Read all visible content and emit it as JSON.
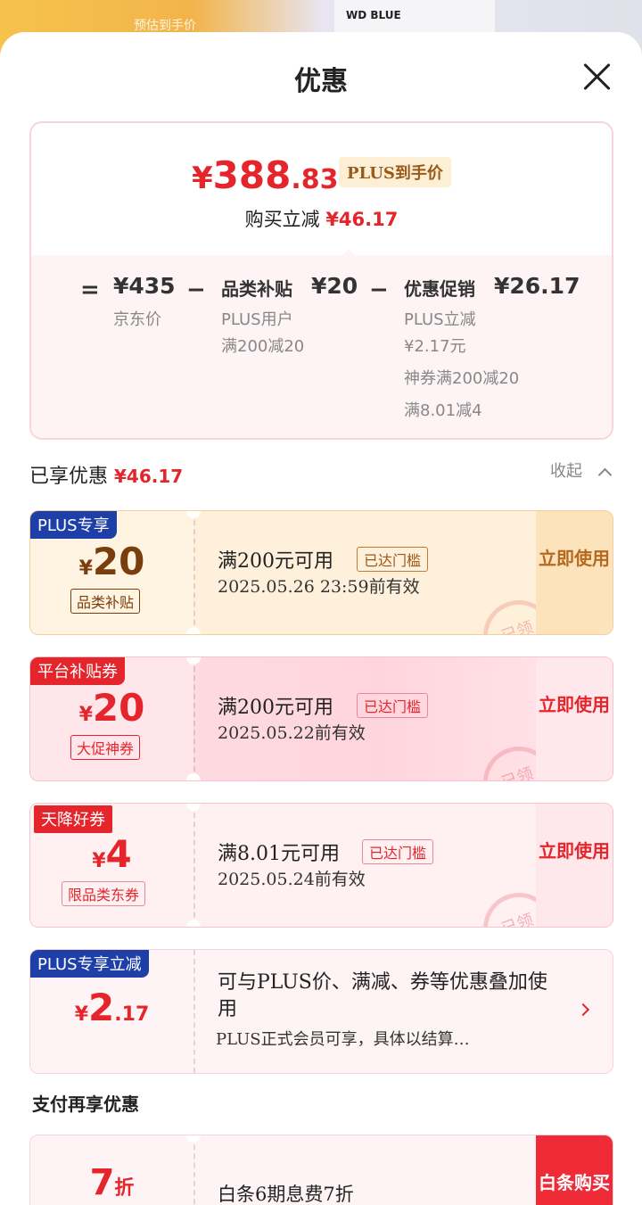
{
  "background": {
    "product_text": "预估到手价",
    "wd_label": "WD BLUE"
  },
  "sheet": {
    "title": "优惠"
  },
  "price_card": {
    "final_yen": "¥",
    "final_int": "388",
    "final_dec": ".83",
    "plus_tag": "PLUS到手价",
    "reduce_prefix": "购买立减",
    "reduce_amount": "¥46.17",
    "equals": "=",
    "jd_price": "¥435",
    "jd_price_label": "京东价",
    "minus1": "−",
    "cat_label": "品类补贴",
    "cat_amount": "¥20",
    "cat_sub1": "PLUS用户",
    "cat_sub2": "满200减20",
    "minus2": "−",
    "promo_label": "优惠促销",
    "promo_amount": "¥26.17",
    "promo_sub1": "PLUS立减",
    "promo_sub2": "¥2.17元",
    "promo_sub3": "神券满200减20",
    "promo_sub4": "满8.01减4"
  },
  "enjoyed": {
    "title": "已享优惠",
    "amount": "¥46.17",
    "collapse_label": "收起"
  },
  "coupons": [
    {
      "badge": "PLUS专享",
      "yen": "¥",
      "amount": "20",
      "tag": "品类补贴",
      "condition": "满200元可用",
      "met": "已达门槛",
      "valid": "2025.05.26 23:59前有效",
      "action": "立即使用",
      "stamp": "已领"
    },
    {
      "badge": "平台补贴券",
      "yen": "¥",
      "amount": "20",
      "tag": "大促神券",
      "condition": "满200元可用",
      "met": "已达门槛",
      "valid": "2025.05.22前有效",
      "action": "立即使用",
      "stamp": "已领"
    },
    {
      "badge": "天降好券",
      "yen": "¥",
      "amount": "4",
      "tag": "限品类东券",
      "condition": "满8.01元可用",
      "met": "已达门槛",
      "valid": "2025.05.24前有效",
      "action": "立即使用",
      "stamp": "已领"
    },
    {
      "badge": "PLUS专享立减",
      "yen": "¥",
      "amount": "2",
      "decimal": ".17",
      "desc1": "可与PLUS价、满减、券等优惠叠加使用",
      "desc2": "PLUS正式会员可享，具体以结算…"
    }
  ],
  "payment": {
    "title": "支付再享优惠",
    "amount": "7",
    "unit": "折",
    "condition": "白条6期息费7折",
    "action": "白条购买"
  },
  "colors": {
    "accent_red": "#e4262c",
    "plus_blue": "#1f3fa8",
    "gold": "#9a5a17"
  }
}
